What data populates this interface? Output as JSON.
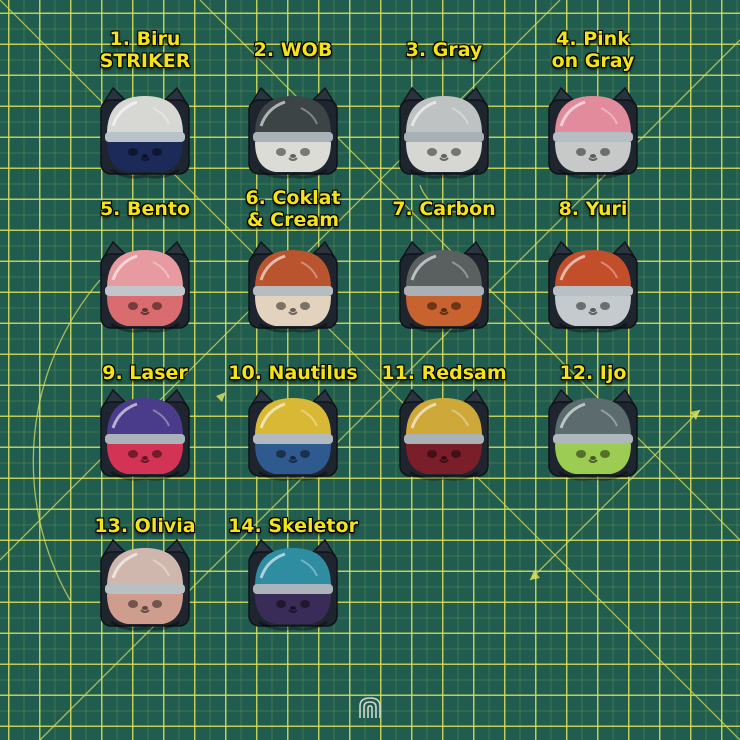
{
  "items": [
    {
      "label": "1. Biru\nSTRIKER",
      "dome": "#d7d8d4",
      "body": "#1c2a5a",
      "visor": "#b9c2c8"
    },
    {
      "label": "2. WOB",
      "dome": "#3c4446",
      "body": "#dcdcd6",
      "visor": "#a8b2b8"
    },
    {
      "label": "3. Gray",
      "dome": "#bfc2c2",
      "body": "#d6d6d2",
      "visor": "#a7b0b4"
    },
    {
      "label": "4. Pink\non Gray",
      "dome": "#e28b9c",
      "body": "#c7c9c9",
      "visor": "#b6bec4"
    },
    {
      "label": "5. Bento",
      "dome": "#e79aa0",
      "body": "#d86c6e",
      "visor": "#c0c6cc"
    },
    {
      "label": "6. Coklat\n& Cream",
      "dome": "#b9542e",
      "body": "#e2d2be",
      "visor": "#b6bcc0"
    },
    {
      "label": "7. Carbon",
      "dome": "#5a5f60",
      "body": "#c8622e",
      "visor": "#a9b1b6"
    },
    {
      "label": "8. Yuri",
      "dome": "#c24e2a",
      "body": "#c4cacd",
      "visor": "#b8c0c6"
    },
    {
      "label": "9. Laser",
      "dome": "#4a3c8a",
      "body": "#d33455",
      "visor": "#aab2ba"
    },
    {
      "label": "10. Nautilus",
      "dome": "#d9b836",
      "body": "#2e5a90",
      "visor": "#b2bac0"
    },
    {
      "label": "11. Redsam",
      "dome": "#cfa83a",
      "body": "#7a1e2a",
      "visor": "#aab2b6"
    },
    {
      "label": "12. Ijo",
      "dome": "#5b6b6e",
      "body": "#9ccc52",
      "visor": "#aeb8bc"
    },
    {
      "label": "13. Olivia",
      "dome": "#cfb7ae",
      "body": "#cf9d8e",
      "visor": "#b8c0c4"
    },
    {
      "label": "14. Skeletor",
      "dome": "#2f8da2",
      "body": "#3a2c58",
      "visor": "#aab4ba"
    }
  ],
  "colors": {
    "label": "#f4e21a",
    "mat": "#215d4e",
    "grid": "#d6de5a"
  },
  "icons": {
    "logo": "fingerprint-logo-icon"
  }
}
